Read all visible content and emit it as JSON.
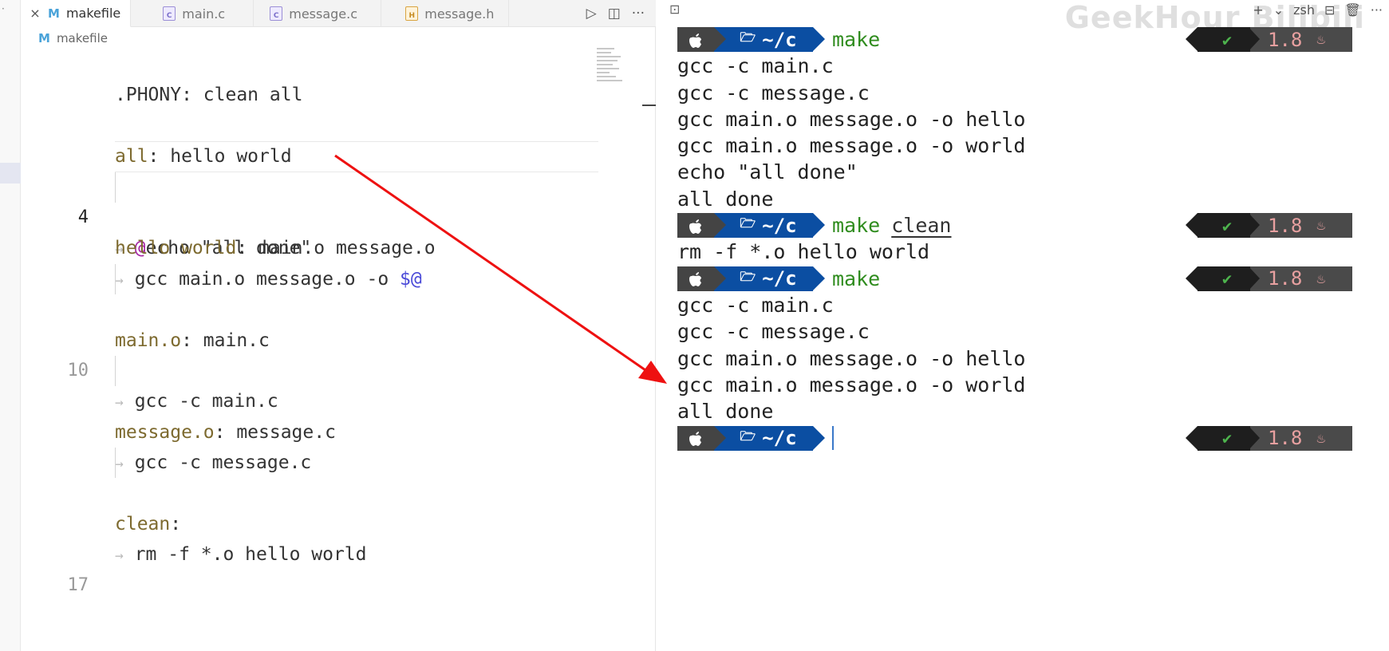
{
  "editor": {
    "activity_dot": "·",
    "tabs": [
      {
        "label": "makefile",
        "icon": "makefile-icon",
        "active": true,
        "close": "×"
      },
      {
        "label": "main.c",
        "icon": "c-file-icon"
      },
      {
        "label": "message.c",
        "icon": "c-file-icon"
      },
      {
        "label": "message.h",
        "icon": "h-file-icon"
      }
    ],
    "actions": {
      "run": "▷",
      "split": "◫",
      "more": "···"
    },
    "breadcrumb": "makefile",
    "line_numbers": {
      "l4": "4",
      "l10": "10",
      "l17": "17"
    },
    "code": {
      "l1_target": ".PHONY",
      "l1_rest": ": clean all",
      "l3_target": "all",
      "l3_rest": ": hello world",
      "l4_at": "@",
      "l4_rest": "echo \"all done\"",
      "l6_target": "hello world",
      "l6_rest": ": main.o message.o",
      "l7_cmd": "gcc main.o message.o -o ",
      "l7_var": "$@",
      "l9_target": "main.o",
      "l9_rest": ": main.c",
      "l10_cmd": "gcc -c main.c",
      "l12_target": "message.o",
      "l12_rest": ": message.c",
      "l13_cmd": "gcc -c message.c",
      "l15_target": "clean",
      "l15_rest": ":",
      "l16_cmd": "rm -f *.o hello world"
    },
    "tab_glyph": "→"
  },
  "terminal": {
    "toolbar": {
      "new": "+",
      "dropdown": "⌄",
      "shell": "zsh",
      "split": "⊟",
      "trash": "🗑",
      "more": "···"
    },
    "watermark": "GeekHour Bilibili",
    "prompt": {
      "dir": "~/c",
      "ok": "✔",
      "version": "1.8"
    },
    "blocks": [
      {
        "cmd": "make",
        "output": [
          "gcc -c main.c",
          "gcc -c message.c",
          "gcc main.o message.o -o hello",
          "gcc main.o message.o -o world",
          "echo \"all done\"",
          "all done"
        ]
      },
      {
        "cmd": "make",
        "arg": "clean",
        "output": [
          "rm -f *.o hello world"
        ]
      },
      {
        "cmd": "make",
        "output": [
          "gcc -c main.c",
          "gcc -c message.c",
          "gcc main.o message.o -o hello",
          "gcc main.o message.o -o world",
          "all done"
        ]
      }
    ]
  },
  "colors": {
    "annotation_arrow": "#ee1111",
    "prompt_dir_bg": "#0b4ea2",
    "command_green": "#2f8c1e"
  }
}
